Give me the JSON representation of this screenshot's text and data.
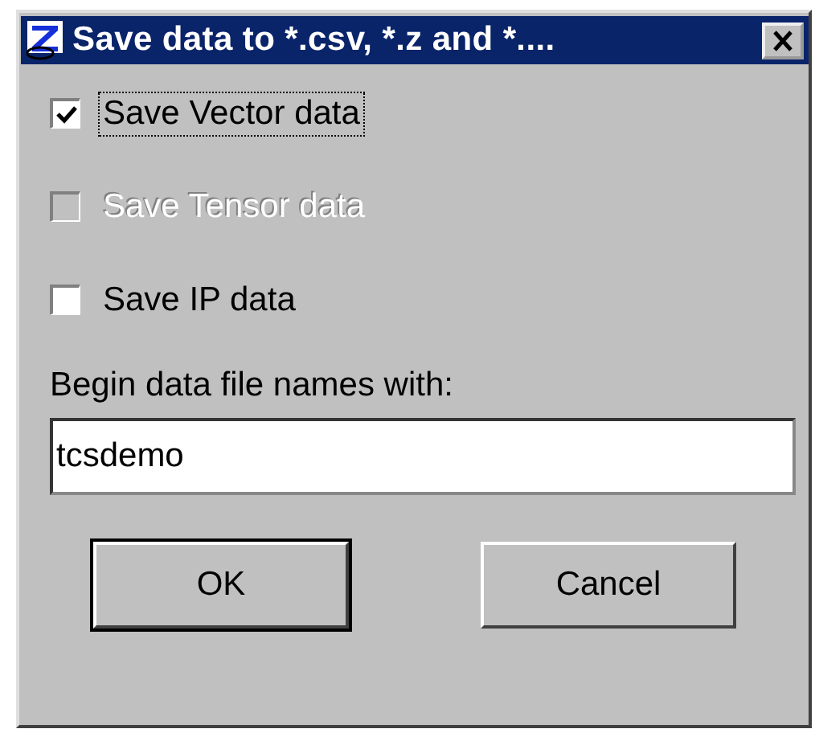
{
  "window": {
    "title": "Save data to *.csv, *.z and *...."
  },
  "checkboxes": [
    {
      "label": "Save Vector data",
      "checked": true,
      "disabled": false,
      "focused": true
    },
    {
      "label": "Save Tensor data",
      "checked": false,
      "disabled": true,
      "focused": false
    },
    {
      "label": "Save IP data",
      "checked": false,
      "disabled": false,
      "focused": false
    }
  ],
  "filename": {
    "label": "Begin data file names with:",
    "value": "tcsdemo"
  },
  "buttons": [
    {
      "label": "OK",
      "default": true
    },
    {
      "label": "Cancel",
      "default": false
    }
  ]
}
